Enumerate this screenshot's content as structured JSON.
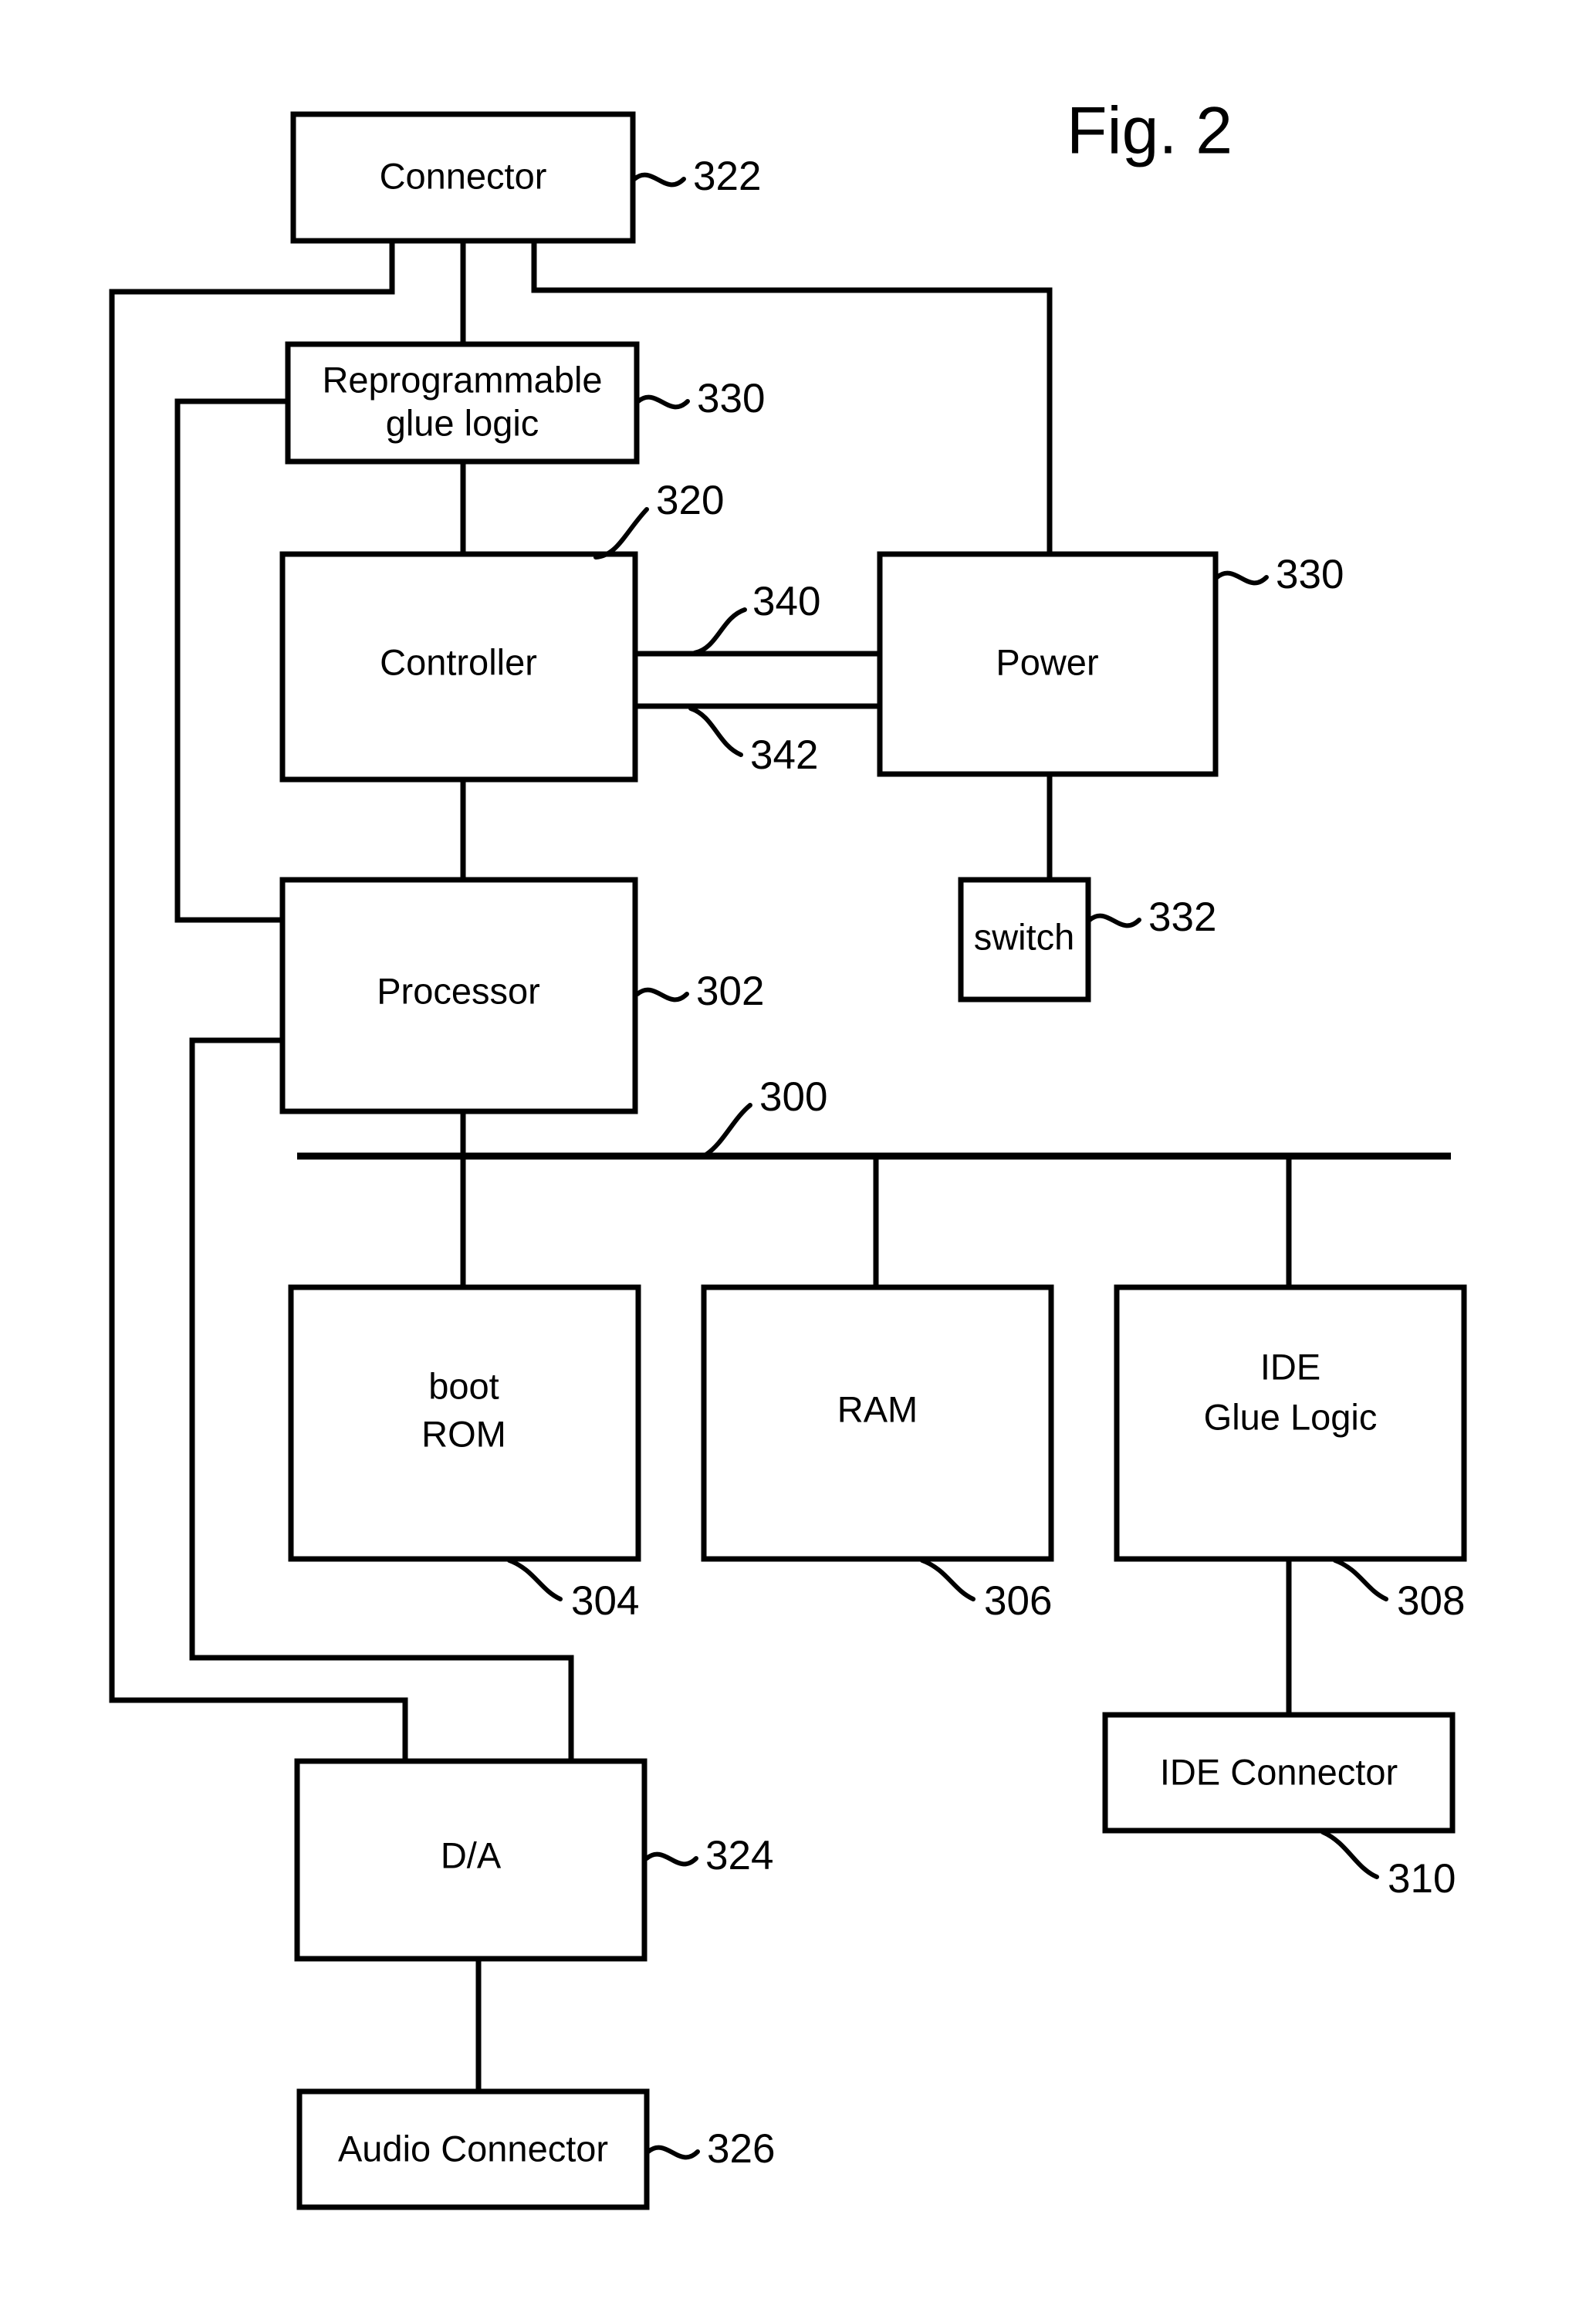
{
  "figure": {
    "title": "Fig. 2",
    "type": "patent-block-diagram"
  },
  "blocks": {
    "connector": {
      "label": "Connector",
      "ref": "322"
    },
    "reprogrammable_glue_logic": {
      "label_line1": "Reprogrammable",
      "label_line2": "glue logic",
      "ref": "330"
    },
    "controller": {
      "label": "Controller",
      "ref": "320"
    },
    "power": {
      "label": "Power",
      "ref": "330"
    },
    "switch": {
      "label": "switch",
      "ref": "332"
    },
    "processor": {
      "label": "Processor",
      "ref": "302"
    },
    "boot_rom": {
      "label_line1": "boot",
      "label_line2": "ROM",
      "ref": "304"
    },
    "ram": {
      "label": "RAM",
      "ref": "306"
    },
    "ide_glue_logic": {
      "label_line1": "IDE",
      "label_line2": "Glue Logic",
      "ref": "308"
    },
    "ide_connector": {
      "label": "IDE Connector",
      "ref": "310"
    },
    "da": {
      "label": "D/A",
      "ref": "324"
    },
    "audio_connector": {
      "label": "Audio Connector",
      "ref": "326"
    }
  },
  "bus": {
    "ref": "300"
  },
  "signals": {
    "controller_power_upper": {
      "ref": "340"
    },
    "controller_power_lower": {
      "ref": "342"
    }
  },
  "colors": {
    "ink": "#000000",
    "paper": "#ffffff"
  }
}
